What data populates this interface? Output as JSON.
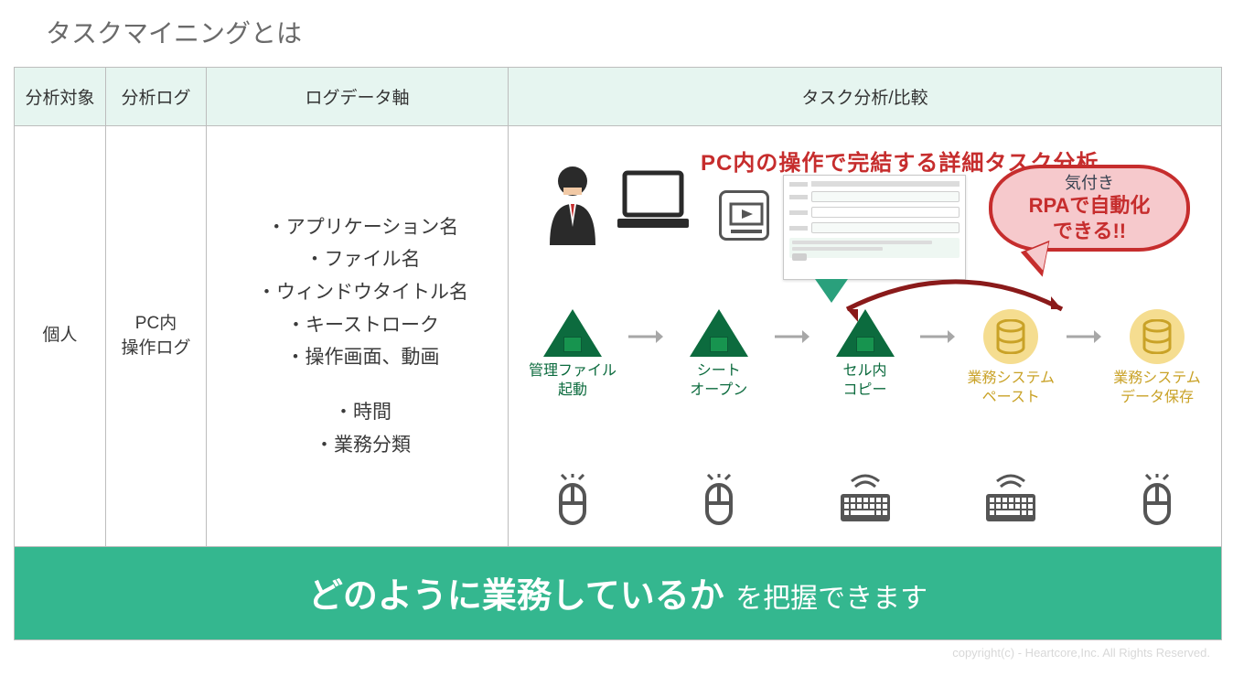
{
  "title": "タスクマイニングとは",
  "headers": {
    "target": "分析対象",
    "log": "分析ログ",
    "axis": "ログデータ軸",
    "task": "タスク分析/比較"
  },
  "row": {
    "target": "個人",
    "log_line1": "PC内",
    "log_line2": "操作ログ",
    "axis_items_a": [
      "・アプリケーション名",
      "・ファイル名",
      "・ウィンドウタイトル名",
      "・キーストローク",
      "・操作画面、動画"
    ],
    "axis_items_b": [
      "・時間",
      "・業務分類"
    ]
  },
  "task": {
    "headline": "PC内の操作で完結する詳細タスク分析",
    "bubble_top": "気付き",
    "bubble_line1": "RPAで自動化",
    "bubble_line2": "できる!!",
    "steps": [
      {
        "label_l1": "管理ファイル",
        "label_l2": "起動",
        "kind": "excel"
      },
      {
        "label_l1": "シート",
        "label_l2": "オープン",
        "kind": "excel"
      },
      {
        "label_l1": "セル内",
        "label_l2": "コピー",
        "kind": "excel"
      },
      {
        "label_l1": "業務システム",
        "label_l2": "ペースト",
        "kind": "db"
      },
      {
        "label_l1": "業務システム",
        "label_l2": "データ保存",
        "kind": "db"
      }
    ],
    "devices": [
      "mouse",
      "mouse",
      "keyboard",
      "keyboard",
      "mouse"
    ]
  },
  "footer": {
    "strong": "どのように業務しているか",
    "rest": "を把握できます"
  },
  "copyright": "copyright(c) - Heartcore,Inc. All Rights Reserved."
}
